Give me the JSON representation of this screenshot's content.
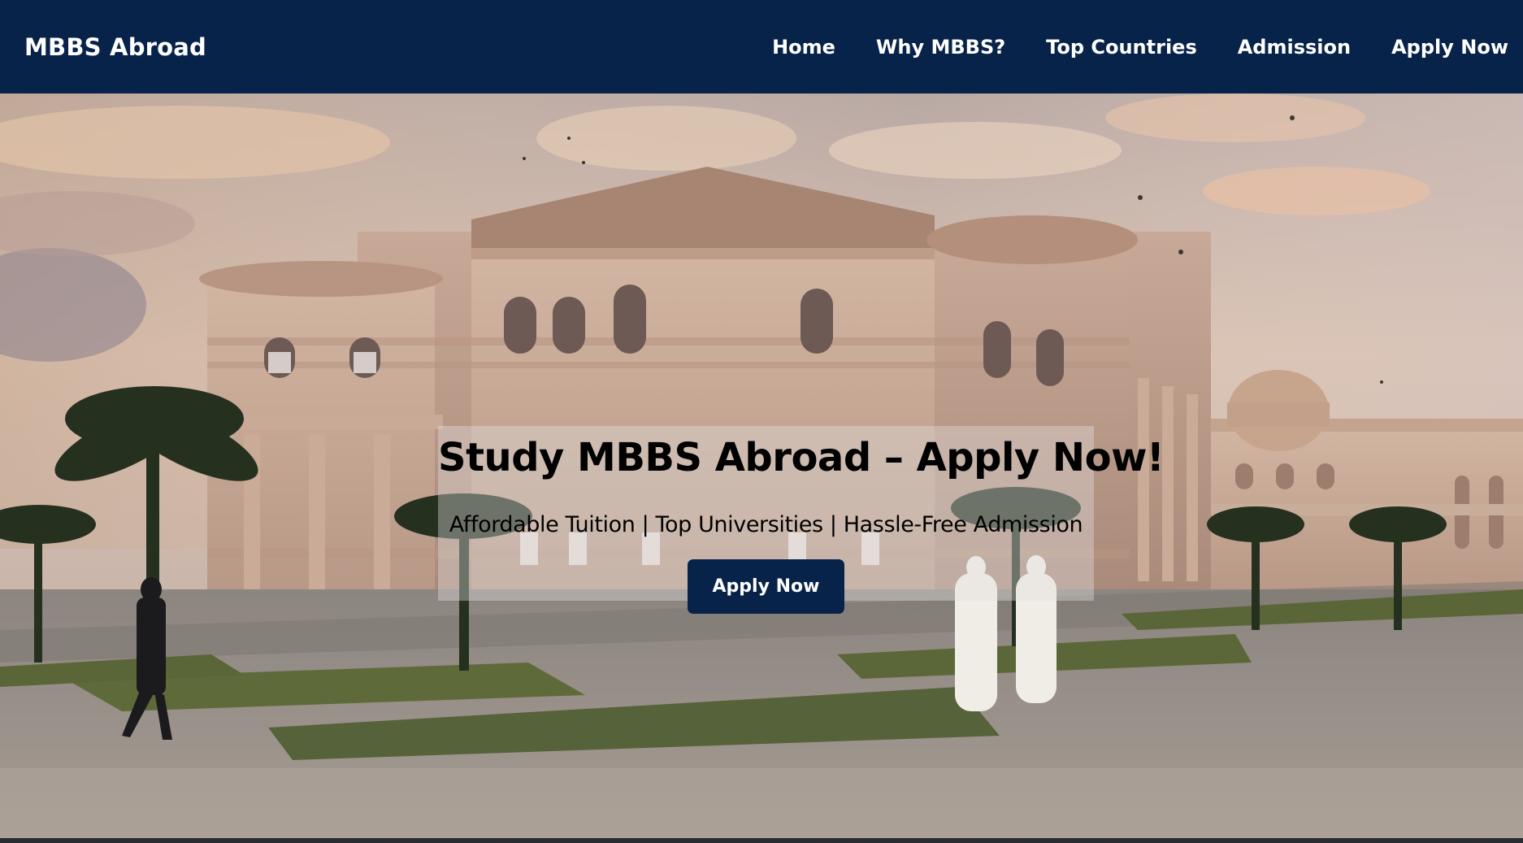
{
  "nav": {
    "brand": "MBBS Abroad",
    "links": [
      {
        "label": "Home"
      },
      {
        "label": "Why MBBS?"
      },
      {
        "label": "Top Countries"
      },
      {
        "label": "Admission"
      },
      {
        "label": "Apply Now"
      }
    ]
  },
  "hero": {
    "title": "Study MBBS Abroad – Apply Now!",
    "subtitle": "Affordable Tuition | Top Universities | Hassle-Free Admission",
    "cta_label": "Apply Now",
    "image_alt": "University campus building with palm trees at sunset"
  },
  "colors": {
    "navbar": "#08234a",
    "cta": "#08234a",
    "text_light": "#ffffff"
  }
}
